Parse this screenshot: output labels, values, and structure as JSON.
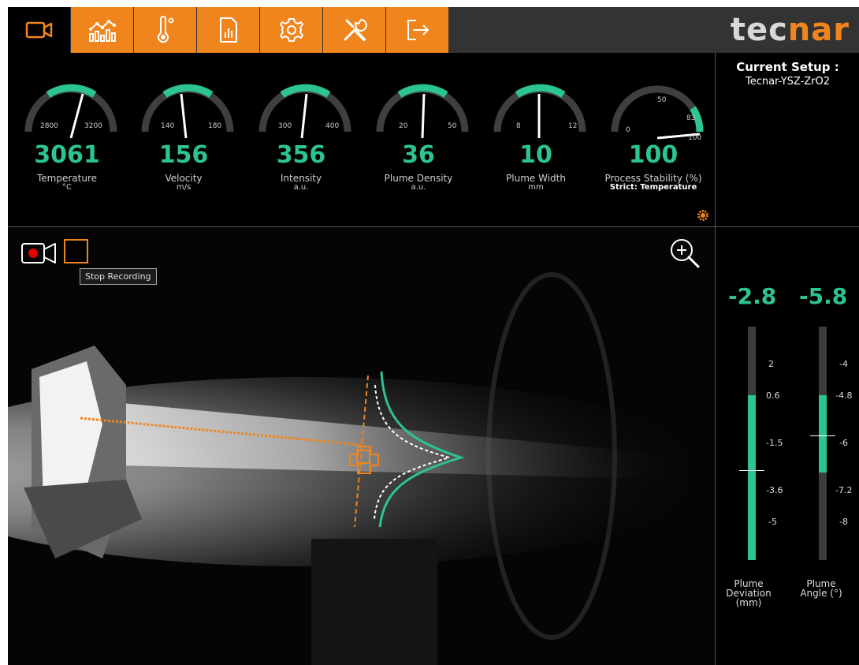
{
  "toolbar": {
    "buttons": [
      {
        "name": "camera",
        "icon": "video-camera-icon"
      },
      {
        "name": "charts",
        "icon": "chart-icon"
      },
      {
        "name": "temperature",
        "icon": "thermometer-icon"
      },
      {
        "name": "report",
        "icon": "report-icon"
      },
      {
        "name": "settings",
        "icon": "gear-icon"
      },
      {
        "name": "tools",
        "icon": "tools-icon"
      },
      {
        "name": "exit",
        "icon": "exit-icon"
      }
    ],
    "accent_color": "#f0851e",
    "logo": "tecnar"
  },
  "setup": {
    "title": "Current Setup :",
    "name": "Tecnar-YSZ-ZrO2"
  },
  "gauges": [
    {
      "value": "3061",
      "label": "Temperature",
      "unit": "°C",
      "min_tick": "2800",
      "max_tick": "3200"
    },
    {
      "value": "156",
      "label": "Velocity",
      "unit": "m/s",
      "min_tick": "140",
      "max_tick": "180"
    },
    {
      "value": "356",
      "label": "Intensity",
      "unit": "a.u.",
      "min_tick": "300",
      "max_tick": "400"
    },
    {
      "value": "36",
      "label": "Plume Density",
      "unit": "a.u.",
      "min_tick": "20",
      "max_tick": "50"
    },
    {
      "value": "10",
      "label": "Plume Width",
      "unit": "mm",
      "min_tick": "8",
      "max_tick": "12"
    },
    {
      "value": "100",
      "label": "Process Stability (%)",
      "unit": "Strict: Temperature",
      "tick_0": "0",
      "tick_50": "50",
      "tick_83": "83",
      "tick_100": "100"
    }
  ],
  "camera": {
    "tooltip": "Stop Recording",
    "record_icon": "record-camera-icon",
    "zoom_icon": "zoom-in-icon"
  },
  "deviation": {
    "value": "-2.8",
    "ticks": [
      "2",
      "0.6",
      "-1.5",
      "-3.6",
      "-5"
    ],
    "label": "Plume Deviation (mm)"
  },
  "angle": {
    "value": "-5.8",
    "ticks": [
      "-4",
      "-4.8",
      "-6",
      "-7.2",
      "-8"
    ],
    "label": "Plume Angle (°)"
  },
  "colors": {
    "green": "#2cc48f",
    "orange": "#f0851e"
  }
}
